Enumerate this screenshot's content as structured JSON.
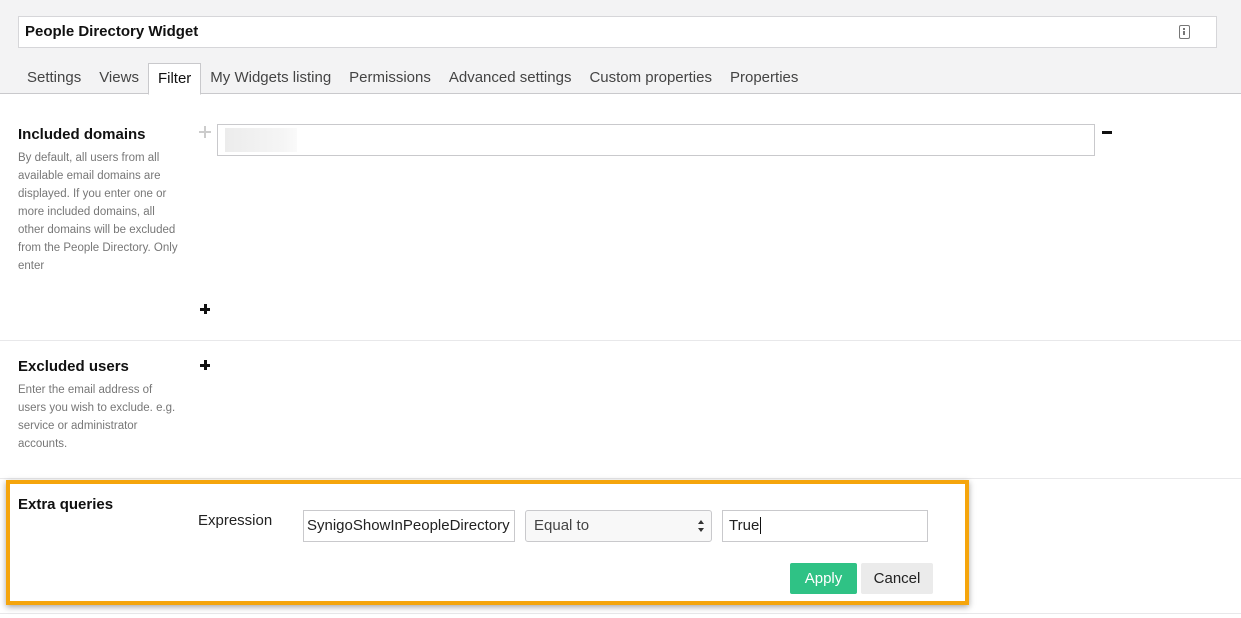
{
  "widget": {
    "title": "People Directory Widget",
    "title_icon": "info-card-icon"
  },
  "tabs": [
    {
      "label": "Settings"
    },
    {
      "label": "Views"
    },
    {
      "label": "Filter",
      "active": true
    },
    {
      "label": "My Widgets listing"
    },
    {
      "label": "Permissions"
    },
    {
      "label": "Advanced settings"
    },
    {
      "label": "Custom properties"
    },
    {
      "label": "Properties"
    }
  ],
  "included_domains": {
    "title": "Included domains",
    "description": "By default, all users from all available email domains are displayed. If you enter one or more included domains, all other domains will be excluded from the People Directory. Only enter",
    "domain_value": ""
  },
  "excluded_users": {
    "title": "Excluded users",
    "description": "Enter the email address of users you wish to exclude. e.g. service or administrator accounts."
  },
  "extra_queries": {
    "title": "Extra queries",
    "expression_label": "Expression",
    "property_value": "SynigoShowInPeopleDirectory",
    "operator_value": "Equal to",
    "compare_value": "True",
    "apply_label": "Apply",
    "cancel_label": "Cancel"
  },
  "colors": {
    "highlight": "#f5a50c",
    "apply_button": "#2fc285"
  }
}
